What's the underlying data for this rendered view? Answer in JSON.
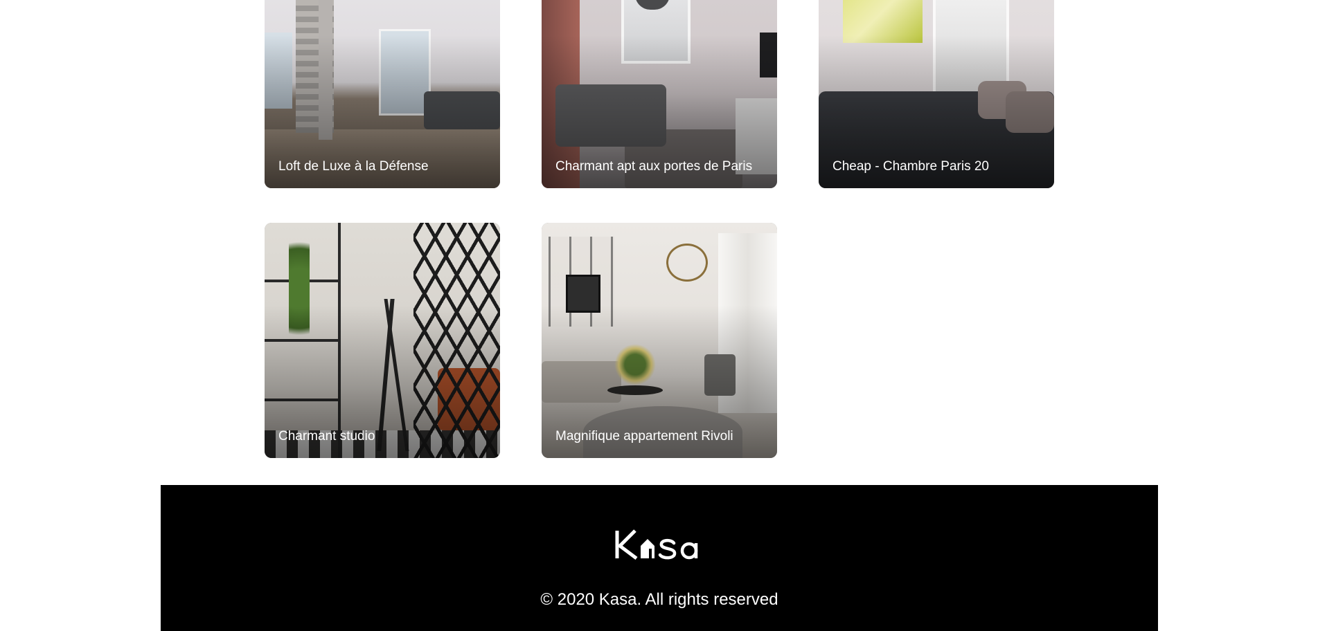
{
  "gallery": {
    "cards": [
      {
        "title": "Loft de Luxe à la Défense"
      },
      {
        "title": "Charmant apt aux portes de Paris"
      },
      {
        "title": "Cheap - Chambre Paris 20"
      },
      {
        "title": "Charmant studio"
      },
      {
        "title": "Magnifique appartement Rivoli"
      }
    ]
  },
  "footer": {
    "logo_text": "Kasa",
    "copyright": "© 2020 Kasa. All rights reserved"
  },
  "colors": {
    "footer_bg": "#000000",
    "footer_text": "#ffffff",
    "card_title": "#ffffff"
  }
}
